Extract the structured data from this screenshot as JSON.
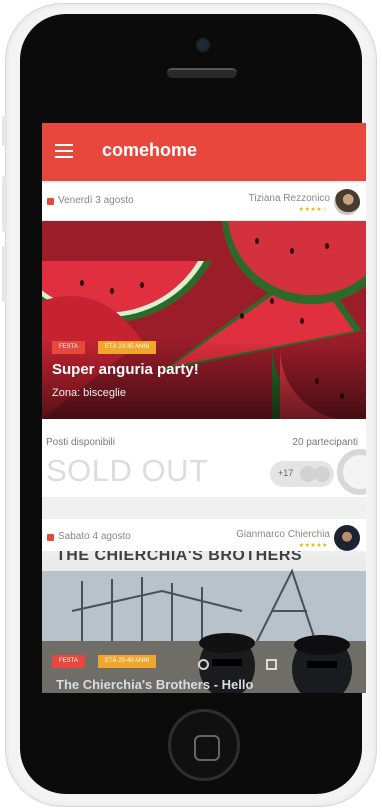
{
  "app": {
    "title": "comehome"
  },
  "events": [
    {
      "date": "Venerdì 3 agosto",
      "host": "Tiziana Rezzonico",
      "host_rating": "★★★★☆",
      "tag_type": "FESTA",
      "tag_age": "ETÀ 23-35 ANNI",
      "name": "Super anguria party!",
      "zone": "Zona: bisceglie",
      "availability_label": "Posti disponibili",
      "participants": "20 partecipanti",
      "status": "SOLD OUT",
      "extra_participants": "+17"
    },
    {
      "date": "Sabato 4 agosto",
      "host": "Gianmarco Chierchia",
      "host_rating": "★★★★★",
      "tag_type": "FESTA",
      "tag_age": "ETÀ 25-40 ANNI",
      "poster_title": "THE CHIERCHIA'S BROTHERS",
      "name": "The Chierchia's Brothers - Hello"
    }
  ],
  "colors": {
    "brand": "#e8473d",
    "tag_age": "#f0a62a",
    "rating": "#e6b800"
  },
  "icons": {
    "menu": "hamburger-icon",
    "calendar": "calendar-icon"
  }
}
